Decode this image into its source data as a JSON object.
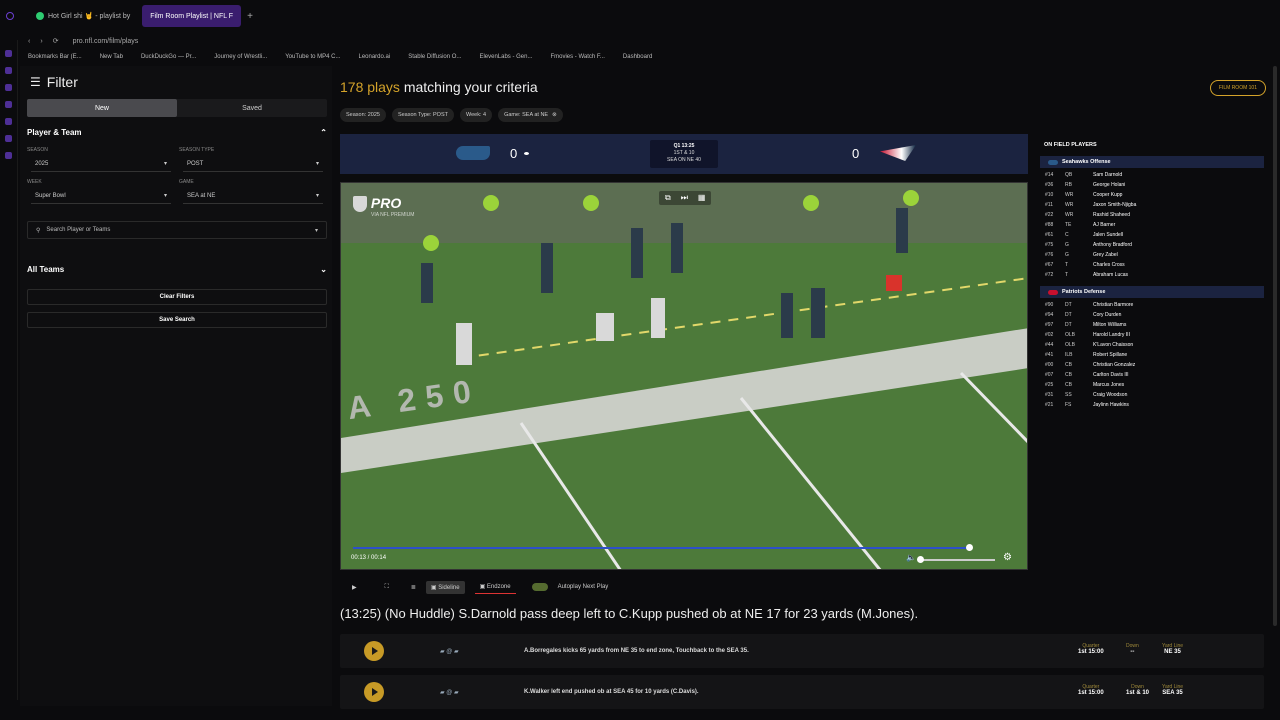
{
  "browser": {
    "tabs": [
      {
        "label": "Hot Girl shi 🤘 - playlist by"
      },
      {
        "label": "Film Room Playlist | NFL F"
      }
    ],
    "url": "pro.nfl.com/film/plays",
    "bookmarks": [
      "Bookmarks Bar (E...",
      "New Tab",
      "DuckDuckGo — Pr...",
      "Journey of Wrestli...",
      "YouTube to MP4 C...",
      "Leonardo.ai",
      "Stable Diffusion O...",
      "ElevenLabs - Gen...",
      "Fmovies - Watch F...",
      "Dashboard"
    ]
  },
  "sidebar": {
    "title": "Filter",
    "tabs": [
      "New",
      "Saved"
    ],
    "section_player_team": "Player & Team",
    "season_label": "SEASON",
    "season_value": "2025",
    "season_type_label": "SEASON TYPE",
    "season_type_value": "POST",
    "week_label": "WEEK",
    "week_value": "Super Bowl",
    "game_label": "GAME",
    "game_value": "SEA at NE",
    "search_placeholder": "Search Player or Teams",
    "section_all_teams": "All Teams",
    "clear_filters": "Clear Filters",
    "save_search": "Save Search"
  },
  "main": {
    "count": "178 plays",
    "count_suffix": "matching your criteria",
    "film_room_button": "FILM ROOM 101",
    "chips": [
      "Season: 2025",
      "Season Type: POST",
      "Week: 4",
      "Game: SEA at NE"
    ],
    "scoreboard": {
      "home_score": "0",
      "away_score": "0",
      "clock_line1": "Q1 13:25",
      "clock_line2": "1ST & 10",
      "clock_line3": "SEA ON NE 40"
    },
    "video": {
      "brand": "PRO",
      "brand_sub": "VIA NFL PREMIUM",
      "time": "00:13 / 00:14",
      "field_number": "A 250"
    },
    "controls": {
      "sideline": "Sideline",
      "endzone": "Endzone",
      "autoplay": "Autoplay Next Play"
    },
    "play_description": "(13:25) (No Huddle) S.Darnold pass deep left to C.Kupp pushed ob at NE 17 for 23 yards (M.Jones).",
    "plays": [
      {
        "text": "A.Borregales kicks 65 yards from NE 35 to end zone, Touchback to the SEA 35.",
        "quarter": "1st 15:00",
        "down": "--",
        "yardline": "NE 35"
      },
      {
        "text": "K.Walker left end pushed ob at SEA 45 for 10 yards (C.Davis).",
        "quarter": "1st 15:00",
        "down": "1st & 10",
        "yardline": "SEA 35"
      }
    ],
    "meta_labels": {
      "quarter": "Quarter",
      "down": "Down",
      "yardline": "Yard Line"
    }
  },
  "roster": {
    "title": "ON FIELD PLAYERS",
    "offense_title": "Seahawks Offense",
    "offense": [
      {
        "n": "#14",
        "p": "QB",
        "name": "Sam Darnold"
      },
      {
        "n": "#36",
        "p": "RB",
        "name": "George Holani"
      },
      {
        "n": "#10",
        "p": "WR",
        "name": "Cooper Kupp"
      },
      {
        "n": "#11",
        "p": "WR",
        "name": "Jaxon Smith-Njigba"
      },
      {
        "n": "#22",
        "p": "WR",
        "name": "Rashid Shaheed"
      },
      {
        "n": "#88",
        "p": "TE",
        "name": "AJ Barner"
      },
      {
        "n": "#61",
        "p": "C",
        "name": "Jalen Sundell"
      },
      {
        "n": "#75",
        "p": "G",
        "name": "Anthony Bradford"
      },
      {
        "n": "#76",
        "p": "G",
        "name": "Grey Zabel"
      },
      {
        "n": "#67",
        "p": "T",
        "name": "Charles Cross"
      },
      {
        "n": "#72",
        "p": "T",
        "name": "Abraham Lucas"
      }
    ],
    "defense_title": "Patriots Defense",
    "defense": [
      {
        "n": "#90",
        "p": "DT",
        "name": "Christian Barmore"
      },
      {
        "n": "#94",
        "p": "DT",
        "name": "Cory Durden"
      },
      {
        "n": "#97",
        "p": "DT",
        "name": "Milton Williams"
      },
      {
        "n": "#02",
        "p": "OLB",
        "name": "Harold Landry III"
      },
      {
        "n": "#44",
        "p": "OLB",
        "name": "K'Lavon Chaisson"
      },
      {
        "n": "#41",
        "p": "ILB",
        "name": "Robert Spillane"
      },
      {
        "n": "#00",
        "p": "CB",
        "name": "Christian Gonzalez"
      },
      {
        "n": "#07",
        "p": "CB",
        "name": "Carlton Davis III"
      },
      {
        "n": "#25",
        "p": "CB",
        "name": "Marcus Jones"
      },
      {
        "n": "#31",
        "p": "SS",
        "name": "Craig Woodson"
      },
      {
        "n": "#21",
        "p": "FS",
        "name": "Jaylinn Hawkins"
      }
    ]
  }
}
